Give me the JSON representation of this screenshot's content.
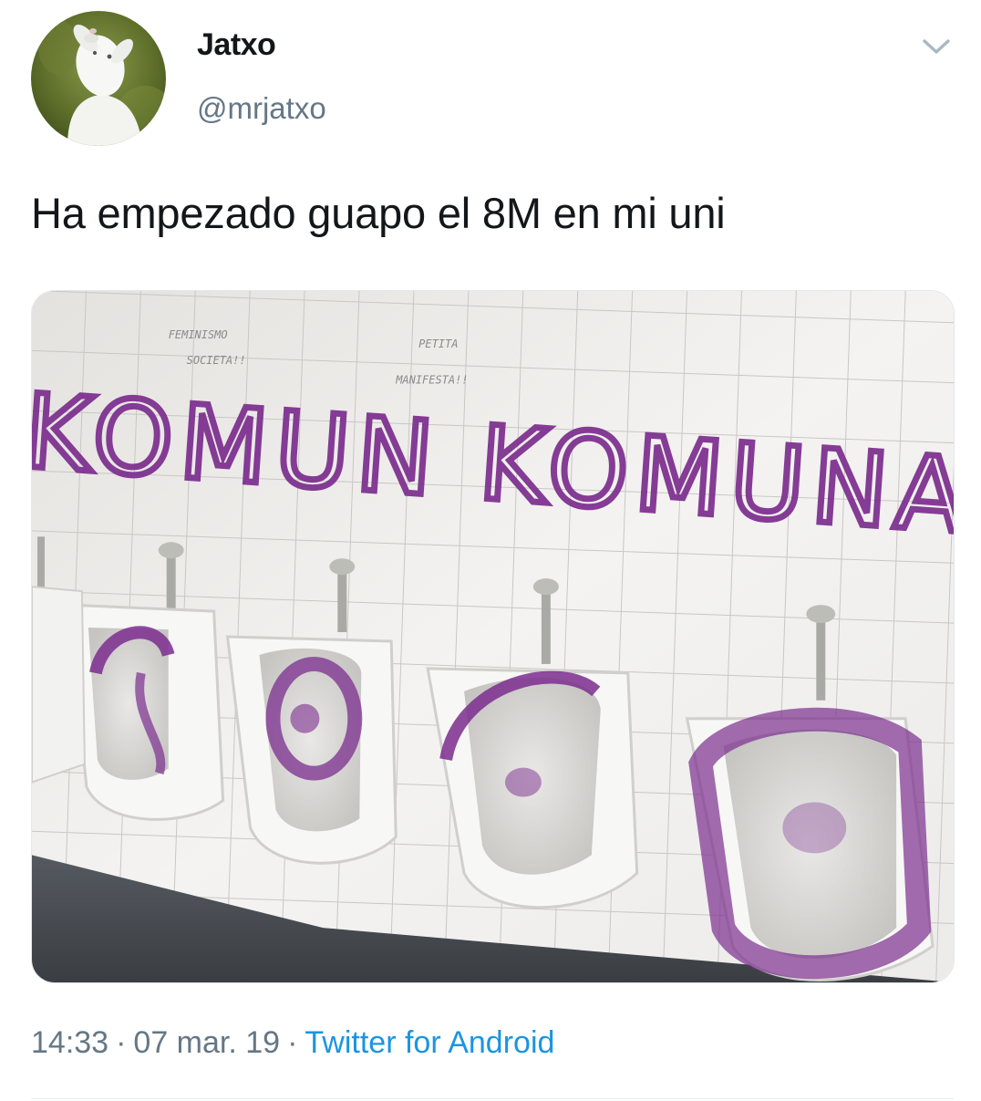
{
  "user": {
    "display_name": "Jatxo",
    "handle": "@mrjatxo"
  },
  "tweet": {
    "text": "Ha empezado guapo el 8M en mi uni",
    "time": "14:33",
    "date": "07 mar. 19",
    "separator": "·",
    "source": "Twitter for Android"
  },
  "media": {
    "graffiti_main": "KOMUN KOMUNAK",
    "graffiti_small_1": "FEMINISMO",
    "graffiti_small_2": "SOCIETA!!",
    "graffiti_small_3": "PETITA",
    "graffiti_small_4": "MANIFESTA!!"
  },
  "icons": {
    "caret": "chevron-down-icon",
    "avatar": "goat-avatar"
  },
  "colors": {
    "text_primary": "#14171a",
    "text_secondary": "#657786",
    "link": "#1b95e0",
    "graffiti": "#7b2d8e"
  }
}
